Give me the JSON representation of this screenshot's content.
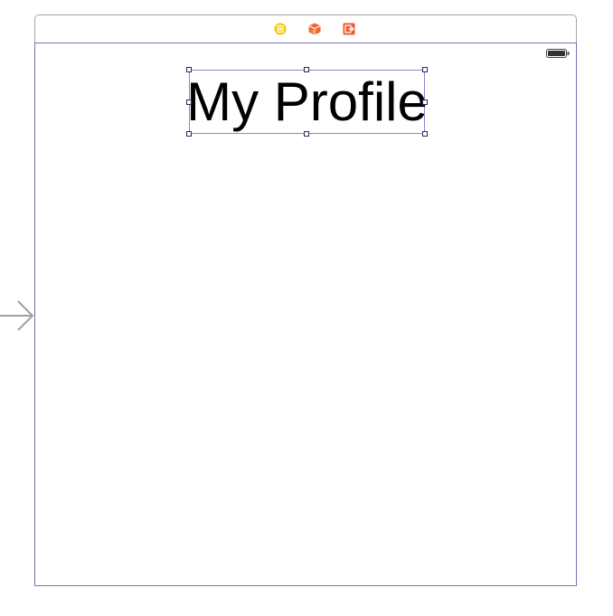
{
  "storyboard": {
    "scene": {
      "dock_icons": [
        {
          "name": "view-controller-icon",
          "color": "#f5c400"
        },
        {
          "name": "first-responder-icon",
          "color": "#f0692f"
        },
        {
          "name": "exit-icon",
          "color": "#ee5a2a"
        }
      ],
      "status_bar": {
        "battery_icon": "battery-icon"
      },
      "label": {
        "text": "My Profile",
        "selected": true
      },
      "is_initial_view_controller": true
    }
  }
}
